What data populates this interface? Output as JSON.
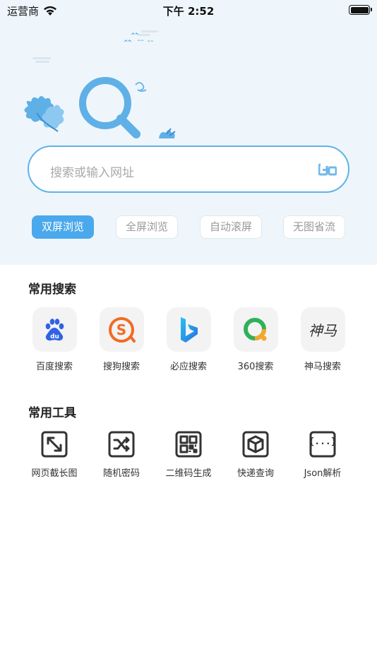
{
  "status_bar": {
    "carrier": "运营商",
    "time": "下午 2:52"
  },
  "search": {
    "placeholder": "搜索或输入网址",
    "go_label": "Go"
  },
  "modes": [
    {
      "label": "双屏浏览",
      "active": true
    },
    {
      "label": "全屏浏览",
      "active": false
    },
    {
      "label": "自动滚屏",
      "active": false
    },
    {
      "label": "无图省流",
      "active": false
    }
  ],
  "engines_section": {
    "title": "常用搜索",
    "items": [
      {
        "label": "百度搜索",
        "icon": "baidu-icon",
        "color": "#2f62e6"
      },
      {
        "label": "搜狗搜索",
        "icon": "sogou-icon",
        "color": "#f26b21"
      },
      {
        "label": "必应搜索",
        "icon": "bing-icon",
        "color": "#1ea7e6"
      },
      {
        "label": "360搜索",
        "icon": "360-icon",
        "color": "#2fb15a"
      },
      {
        "label": "神马搜索",
        "icon": "shenma-icon",
        "icon_text": "神马",
        "color": "#333333"
      }
    ]
  },
  "tools_section": {
    "title": "常用工具",
    "items": [
      {
        "label": "网页截长图",
        "icon": "expand-icon"
      },
      {
        "label": "随机密码",
        "icon": "shuffle-icon"
      },
      {
        "label": "二维码生成",
        "icon": "qrcode-icon"
      },
      {
        "label": "快递查询",
        "icon": "package-icon"
      },
      {
        "label": "Json解析",
        "icon": "json-braces-icon",
        "icon_text": "{...}"
      }
    ]
  },
  "colors": {
    "accent": "#4aa8ec",
    "hero_bg": "#eef6fc",
    "search_border": "#5fb3ea"
  }
}
